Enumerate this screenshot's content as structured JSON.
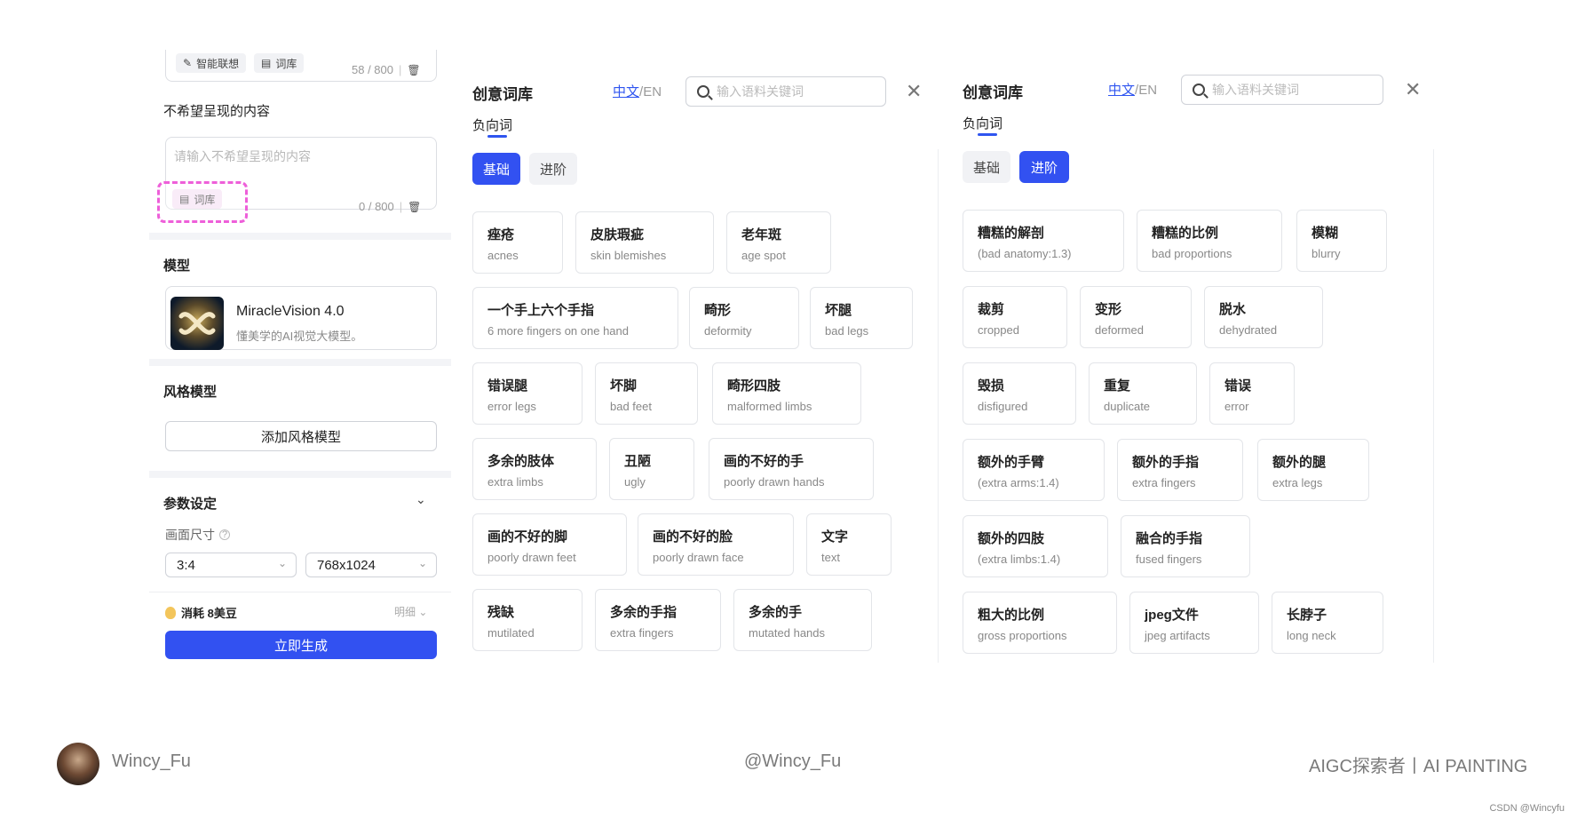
{
  "left": {
    "chip_smart": "智能联想",
    "chip_lexicon": "词库",
    "prompt_counter": "58 / 800",
    "negative_title": "不希望呈现的内容",
    "negative_placeholder": "请输入不希望呈现的内容",
    "negative_lexicon": "词库",
    "negative_counter": "0 / 800",
    "model_title": "模型",
    "model_name": "MiracleVision 4.0",
    "model_desc": "懂美学的AI视觉大模型。",
    "style_title": "风格模型",
    "add_style": "添加风格模型",
    "params_title": "参数设定",
    "canvas_size_label": "画面尺寸",
    "ratio_value": "3:4",
    "size_value": "768x1024",
    "consume": "消耗 8美豆",
    "details": "明细",
    "generate": "立即生成"
  },
  "lib_basic": {
    "title": "创意词库",
    "lang_cn": "中文",
    "lang_sep": "/",
    "lang_en": "EN",
    "search_placeholder": "输入语料关键词",
    "neg_tab": "负向词",
    "seg_basic": "基础",
    "seg_advanced": "进阶",
    "tags": [
      {
        "zh": "痤疮",
        "en": "acnes"
      },
      {
        "zh": "皮肤瑕疵",
        "en": "skin blemishes"
      },
      {
        "zh": "老年斑",
        "en": "age spot"
      },
      {
        "zh": "一个手上六个手指",
        "en": "6 more fingers on one hand"
      },
      {
        "zh": "畸形",
        "en": "deformity"
      },
      {
        "zh": "坏腿",
        "en": "bad legs"
      },
      {
        "zh": "错误腿",
        "en": "error legs"
      },
      {
        "zh": "坏脚",
        "en": "bad feet"
      },
      {
        "zh": "畸形四肢",
        "en": "malformed limbs"
      },
      {
        "zh": "多余的肢体",
        "en": "extra limbs"
      },
      {
        "zh": "丑陋",
        "en": "ugly"
      },
      {
        "zh": "画的不好的手",
        "en": "poorly drawn hands"
      },
      {
        "zh": "画的不好的脚",
        "en": "poorly drawn feet"
      },
      {
        "zh": "画的不好的脸",
        "en": "poorly drawn face"
      },
      {
        "zh": "文字",
        "en": "text"
      },
      {
        "zh": "残缺",
        "en": "mutilated"
      },
      {
        "zh": "多余的手指",
        "en": "extra fingers"
      },
      {
        "zh": "多余的手",
        "en": "mutated hands"
      }
    ]
  },
  "lib_advanced": {
    "title": "创意词库",
    "lang_cn": "中文",
    "lang_sep": "/",
    "lang_en": "EN",
    "search_placeholder": "输入语料关键词",
    "neg_tab": "负向词",
    "seg_basic": "基础",
    "seg_advanced": "进阶",
    "tags": [
      {
        "zh": "糟糕的解剖",
        "en": "(bad anatomy:1.3)"
      },
      {
        "zh": "糟糕的比例",
        "en": "bad proportions"
      },
      {
        "zh": "模糊",
        "en": "blurry"
      },
      {
        "zh": "裁剪",
        "en": "cropped"
      },
      {
        "zh": "变形",
        "en": "deformed"
      },
      {
        "zh": "脱水",
        "en": "dehydrated"
      },
      {
        "zh": "毁损",
        "en": "disfigured"
      },
      {
        "zh": "重复",
        "en": "duplicate"
      },
      {
        "zh": "错误",
        "en": "error"
      },
      {
        "zh": "额外的手臂",
        "en": "(extra arms:1.4)"
      },
      {
        "zh": "额外的手指",
        "en": "extra fingers"
      },
      {
        "zh": "额外的腿",
        "en": "extra legs"
      },
      {
        "zh": "额外的四肢",
        "en": "(extra limbs:1.4)"
      },
      {
        "zh": "融合的手指",
        "en": "fused fingers"
      },
      {
        "zh": "粗大的比例",
        "en": "gross proportions"
      },
      {
        "zh": "jpeg文件",
        "en": "jpeg artifacts"
      },
      {
        "zh": "长脖子",
        "en": "long neck"
      }
    ]
  },
  "footer": {
    "author": "Wincy_Fu",
    "handle": "@Wincy_Fu",
    "tagline": "AIGC探索者丨AI PAINTING",
    "watermark": "CSDN @Wincyfu"
  }
}
